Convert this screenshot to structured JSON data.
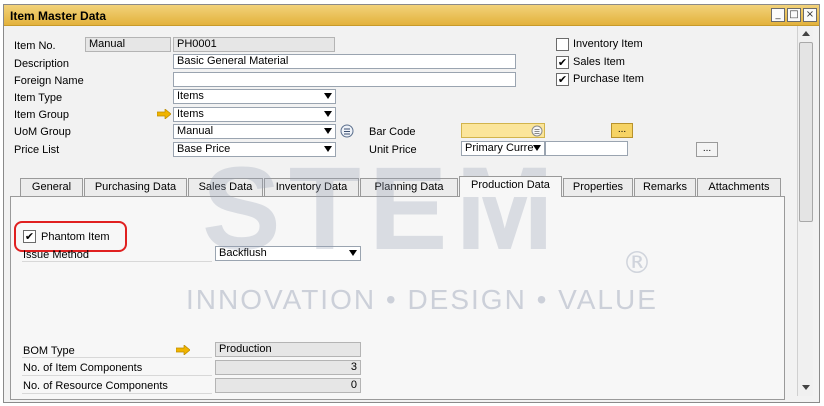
{
  "window": {
    "title": "Item Master Data",
    "controls": {
      "minimize": "_",
      "maximize": "□",
      "close": "×"
    }
  },
  "header": {
    "item_no": {
      "label": "Item No.",
      "series": "Manual",
      "value": "PH0001"
    },
    "description": {
      "label": "Description",
      "value": "Basic General Material"
    },
    "foreign_name": {
      "label": "Foreign Name",
      "value": ""
    },
    "item_type": {
      "label": "Item Type",
      "value": "Items"
    },
    "item_group": {
      "label": "Item Group",
      "value": "Items"
    },
    "uom_group": {
      "label": "UoM Group",
      "value": "Manual"
    },
    "price_list": {
      "label": "Price List",
      "value": "Base Price"
    },
    "bar_code": {
      "label": "Bar Code",
      "value": ""
    },
    "unit_price": {
      "label": "Unit Price",
      "currency": "Primary Curre",
      "value": ""
    },
    "inventory_item": {
      "label": "Inventory Item",
      "checked": false
    },
    "sales_item": {
      "label": "Sales Item",
      "checked": true
    },
    "purchase_item": {
      "label": "Purchase Item",
      "checked": true
    },
    "browse_label": "..."
  },
  "tabs": [
    {
      "label": "General"
    },
    {
      "label": "Purchasing Data"
    },
    {
      "label": "Sales Data"
    },
    {
      "label": "Inventory Data"
    },
    {
      "label": "Planning Data"
    },
    {
      "label": "Production Data",
      "active": true
    },
    {
      "label": "Properties"
    },
    {
      "label": "Remarks"
    },
    {
      "label": "Attachments"
    }
  ],
  "production": {
    "phantom_item": {
      "label": "Phantom Item",
      "checked": true
    },
    "issue_method": {
      "label": "Issue Method",
      "value": "Backflush"
    },
    "bom_type": {
      "label": "BOM Type",
      "value": "Production"
    },
    "item_components": {
      "label": "No. of Item Components",
      "value": "3"
    },
    "resource_components": {
      "label": "No. of Resource Components",
      "value": "0"
    }
  },
  "watermark": {
    "brand": "STEM",
    "tagline": "INNOVATION • DESIGN • VALUE",
    "registered": "®"
  },
  "colors": {
    "title_bar": "#e3b23c",
    "highlight_ring": "#e02020",
    "link_arrow": "#f0b400"
  }
}
